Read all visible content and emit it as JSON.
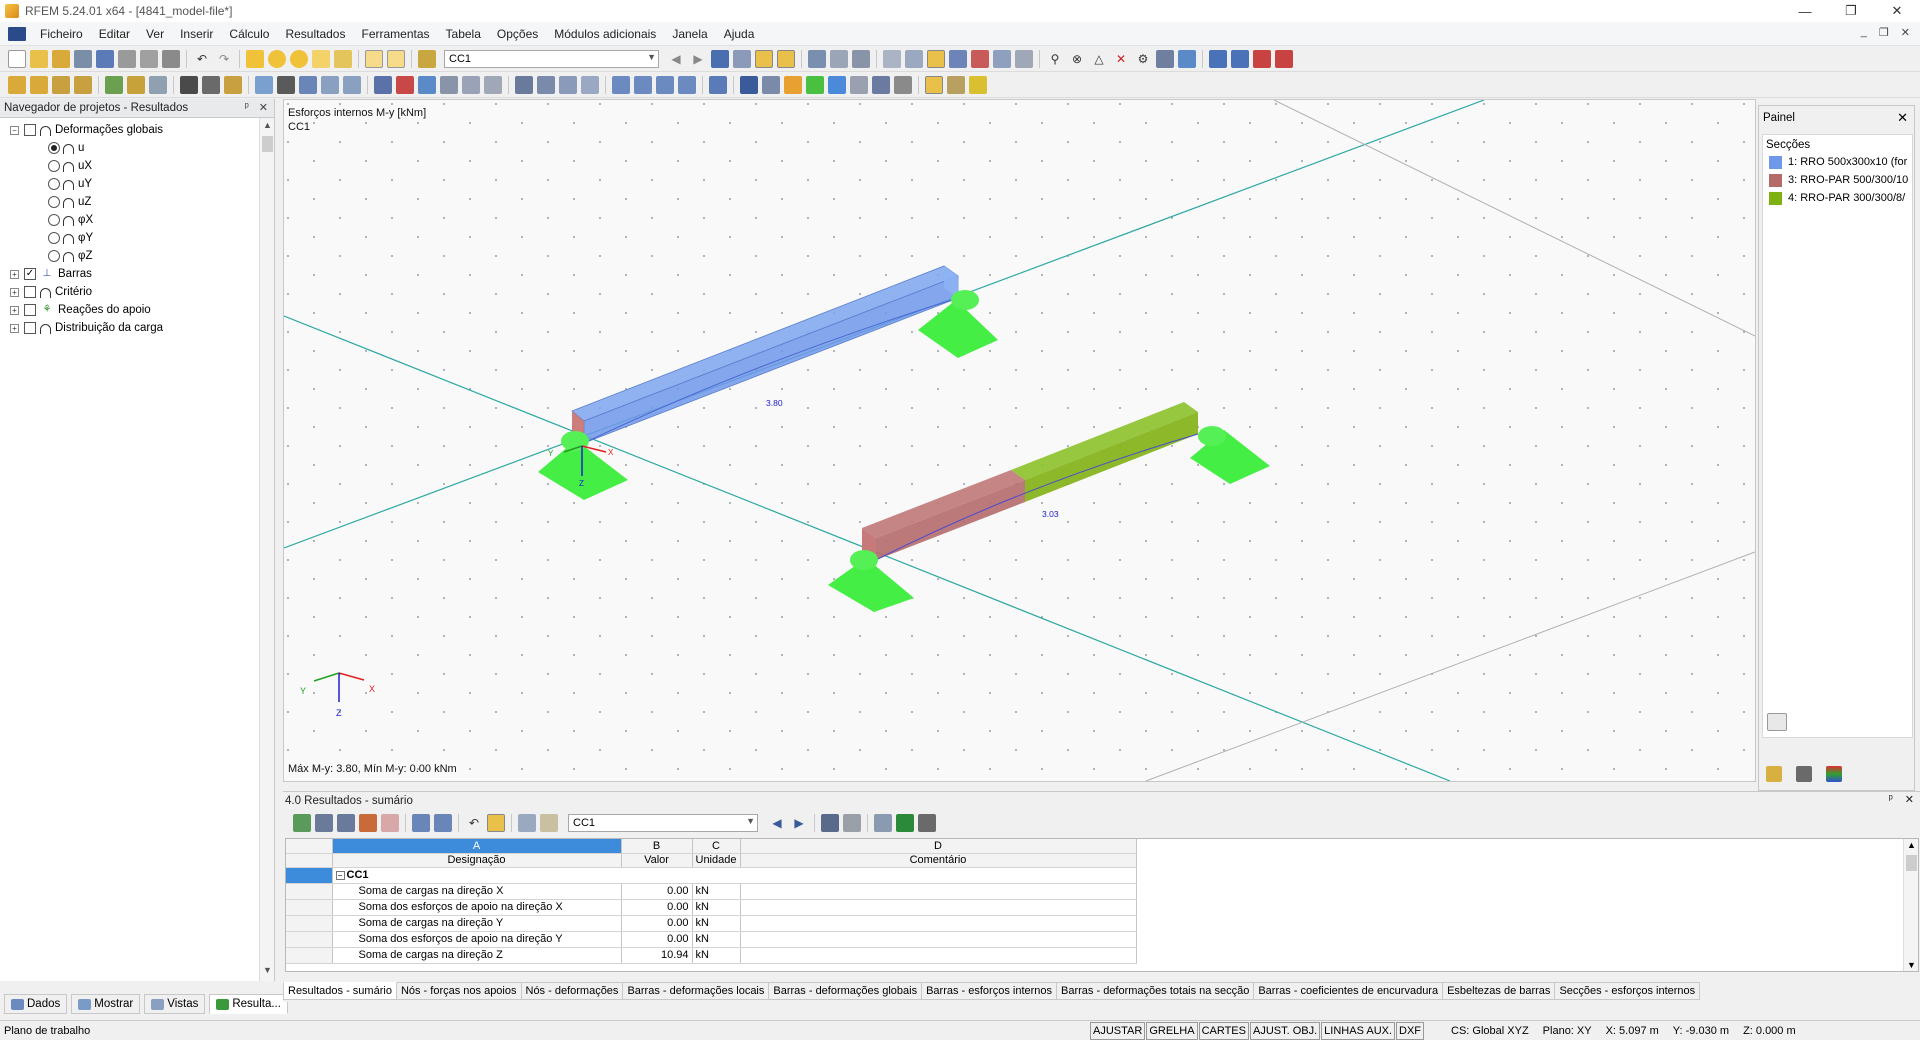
{
  "window": {
    "title": "RFEM 5.24.01 x64 - [4841_model-file*]",
    "controls": [
      "—",
      "❐",
      "✕"
    ]
  },
  "menu": {
    "items": [
      "Ficheiro",
      "Editar",
      "Ver",
      "Inserir",
      "Cálculo",
      "Resultados",
      "Ferramentas",
      "Tabela",
      "Opções",
      "Módulos adicionais",
      "Janela",
      "Ajuda"
    ],
    "mdi_controls": [
      "_",
      "❐",
      "✕"
    ]
  },
  "toolbar": {
    "load_case_combo": "CC1"
  },
  "navigator": {
    "title": "Navegador de projetos - Resultados",
    "header_controls": [
      "ᵖ",
      "✕"
    ],
    "tree": {
      "global_deformations": "Deformações globais",
      "deformation_items": [
        "u",
        "uX",
        "uY",
        "uZ",
        "φX",
        "φY",
        "φZ"
      ],
      "selected_index": 0,
      "members": "Barras",
      "criteria": "Critério",
      "support_reactions": "Reações do apoio",
      "load_distribution": "Distribuição da carga"
    },
    "tabs": [
      "Dados",
      "Mostrar",
      "Vistas",
      "Resulta..."
    ]
  },
  "viewport": {
    "title_line1": "Esforços internos M-y [kNm]",
    "title_line2": "CC1",
    "footer": "Máx M-y: 3.80, Mín M-y: 0.00 kNm",
    "member1_value": "3.80",
    "member2_value": "3.03",
    "axis_labels": {
      "x": "X",
      "y": "Y",
      "z": "Z"
    },
    "colors": {
      "section1": "#6e98ea",
      "section3": "#b56a6a",
      "section4": "#7fb012",
      "support": "#44ee44",
      "gridline": "#2aa7a2"
    }
  },
  "right_panel": {
    "title": "Painel",
    "section_title": "Secções",
    "legend": [
      {
        "label": "1: RRO 500x300x10 (for",
        "color": "#6e98ea"
      },
      {
        "label": "3: RRO-PAR 500/300/10",
        "color": "#b56a6a"
      },
      {
        "label": "4: RRO-PAR 300/300/8/",
        "color": "#7fb012"
      }
    ]
  },
  "results": {
    "title": "4.0 Resultados - sumário",
    "header_controls": [
      "ᵖ",
      "✕"
    ],
    "combo": "CC1",
    "columns": {
      "letters": [
        "A",
        "B",
        "C",
        "D"
      ],
      "names": [
        "Designação",
        "Valor",
        "Unidade",
        "Comentário"
      ]
    },
    "group": "CC1",
    "rows": [
      {
        "designation": "Soma de cargas na direção X",
        "value": "0.00",
        "unit": "kN"
      },
      {
        "designation": "Soma dos esforços de apoio na direção X",
        "value": "0.00",
        "unit": "kN"
      },
      {
        "designation": "Soma de cargas na direção Y",
        "value": "0.00",
        "unit": "kN"
      },
      {
        "designation": "Soma dos esforços de apoio na direção Y",
        "value": "0.00",
        "unit": "kN"
      },
      {
        "designation": "Soma de cargas na direção Z",
        "value": "10.94",
        "unit": "kN"
      }
    ],
    "tabs": [
      "Resultados - sumário",
      "Nós - forças nos apoios",
      "Nós - deformações",
      "Barras - deformações locais",
      "Barras - deformações globais",
      "Barras - esforços internos",
      "Barras - deformações totais na secção",
      "Barras - coeficientes de encurvadura",
      "Esbeltezas de barras",
      "Secções - esforços internos"
    ]
  },
  "statusbar": {
    "left": "Plano de trabalho",
    "buttons": [
      "AJUSTAR",
      "GRELHA",
      "CARTES",
      "AJUST. OBJ.",
      "LINHAS AUX.",
      "DXF"
    ],
    "cs": "CS: Global XYZ",
    "plane": "Plano: XY",
    "x": "X:  5.097 m",
    "y": "Y:  -9.030 m",
    "z": "Z:  0.000 m"
  }
}
